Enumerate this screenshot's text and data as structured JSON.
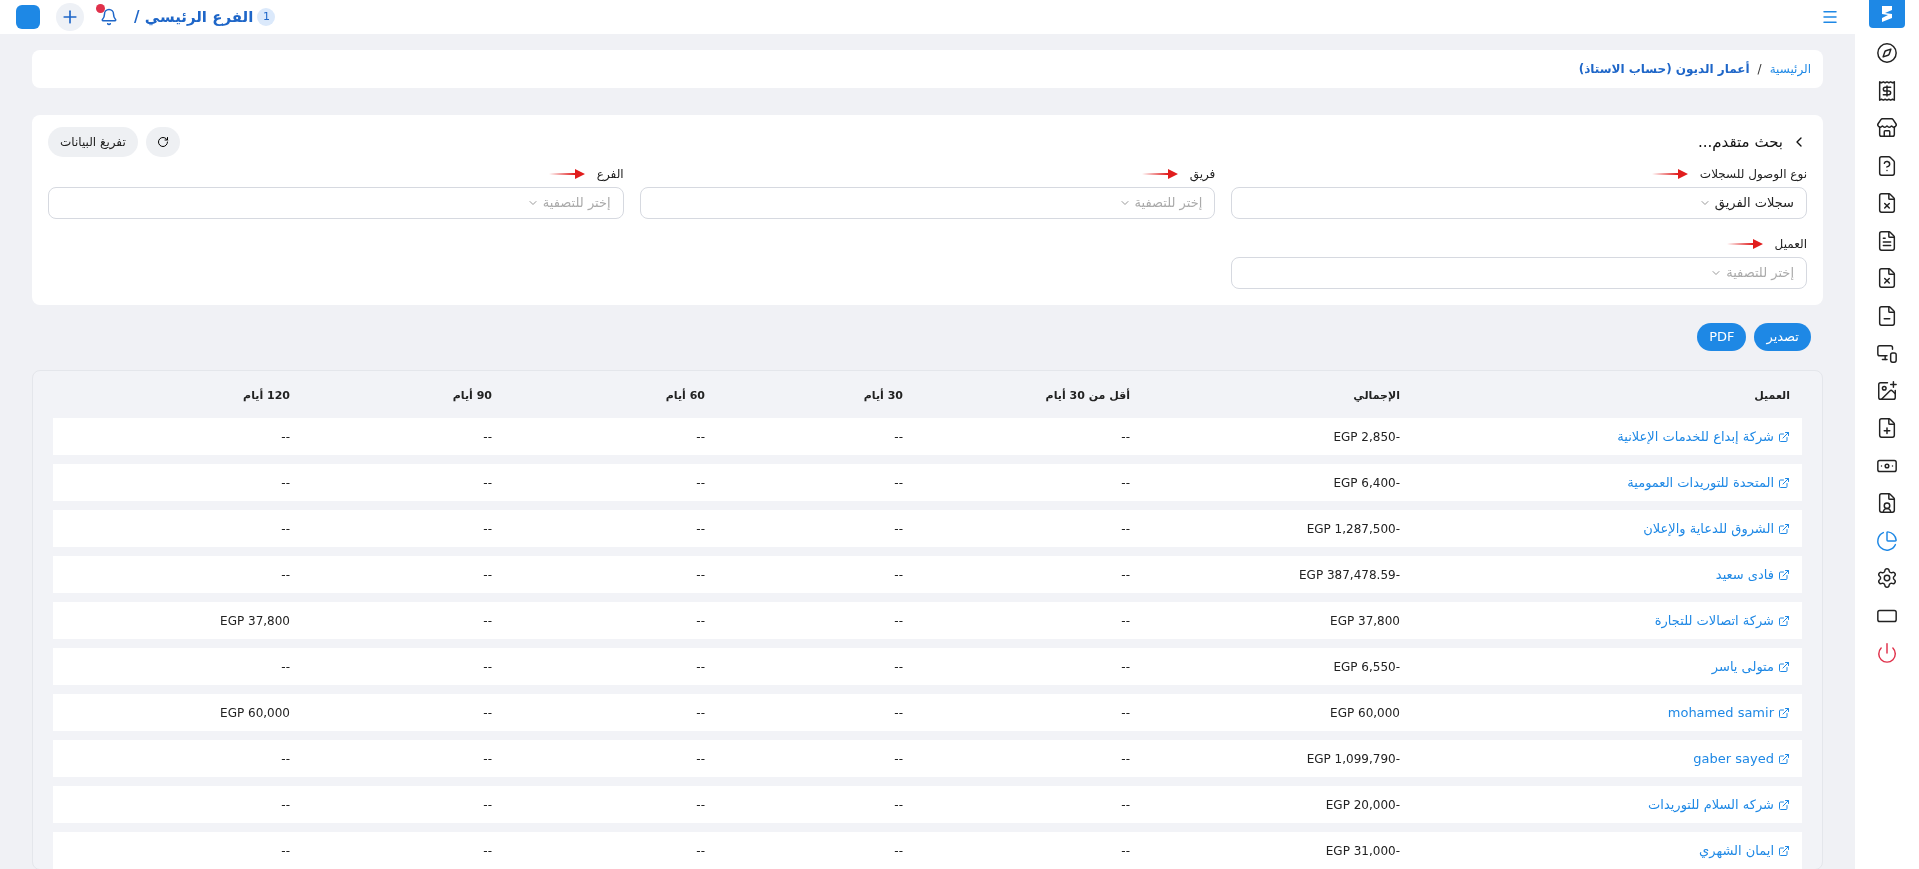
{
  "topbar": {
    "branch_count": "1",
    "branch": "الفرع الرئيسي /",
    "notifications_badge": true
  },
  "breadcrumb": {
    "home": "الرئيسية",
    "separator": "/",
    "current": "أعمار الديون (حساب الاستاذ)"
  },
  "search_panel": {
    "title": "بحث متقدم...",
    "expanded": true,
    "clear_button": "تفريغ البيانات",
    "filters": [
      {
        "label": "نوع الوصول للسجلات",
        "value": "سجلات الفريق"
      },
      {
        "label": "فريق",
        "placeholder": "إختر للتصفية"
      },
      {
        "label": "الفرع",
        "placeholder": "إختر للتصفية"
      },
      {
        "label": "العميل",
        "placeholder": "إختر للتصفية"
      }
    ]
  },
  "export_buttons": [
    "تصدير",
    "PDF"
  ],
  "table": {
    "columns": [
      "العميل",
      "الإجمالي",
      "أقل من 30 أيام",
      "30 أيام",
      "60 أيام",
      "90 أيام",
      "120 أيام"
    ],
    "rows": [
      [
        "شركة إبداع للخدمات الإعلانية",
        "EGP 2,850-",
        "--",
        "--",
        "--",
        "--",
        "--"
      ],
      [
        "المتحدة للتوريدات العمومية",
        "EGP 6,400-",
        "--",
        "--",
        "--",
        "--",
        "--"
      ],
      [
        "الشروق للدعاية والإعلان",
        "EGP 1,287,500-",
        "--",
        "--",
        "--",
        "--",
        "--"
      ],
      [
        "فادى سعيد",
        "EGP 387,478.59-",
        "--",
        "--",
        "--",
        "--",
        "--"
      ],
      [
        "شركة اتصالات للتجارة",
        "EGP 37,800",
        "--",
        "--",
        "--",
        "--",
        "EGP 37,800"
      ],
      [
        "متولى ياسر",
        "EGP 6,550-",
        "--",
        "--",
        "--",
        "--",
        "--"
      ],
      [
        "mohamed samir",
        "EGP 60,000",
        "--",
        "--",
        "--",
        "--",
        "EGP 60,000"
      ],
      [
        "gaber sayed",
        "EGP 1,099,790-",
        "--",
        "--",
        "--",
        "--",
        "--"
      ],
      [
        "شركه السلام للتوريدات",
        "EGP 20,000-",
        "--",
        "--",
        "--",
        "--",
        "--"
      ],
      [
        "ايمان الشهري",
        "EGP 31,000-",
        "--",
        "--",
        "--",
        "--",
        "--"
      ]
    ]
  },
  "sidebar": {
    "items": [
      {
        "selected": false
      },
      {
        "selected": false
      },
      {
        "selected": false
      },
      {
        "selected": false
      },
      {
        "selected": false
      },
      {
        "selected": false
      },
      {
        "selected": false
      },
      {
        "selected": false
      },
      {
        "selected": false
      },
      {
        "selected": false
      },
      {
        "selected": false
      },
      {
        "selected": false
      },
      {
        "selected": false
      },
      {
        "selected": true
      },
      {
        "selected": false
      },
      {
        "selected": false
      },
      {
        "selected": false
      }
    ]
  }
}
